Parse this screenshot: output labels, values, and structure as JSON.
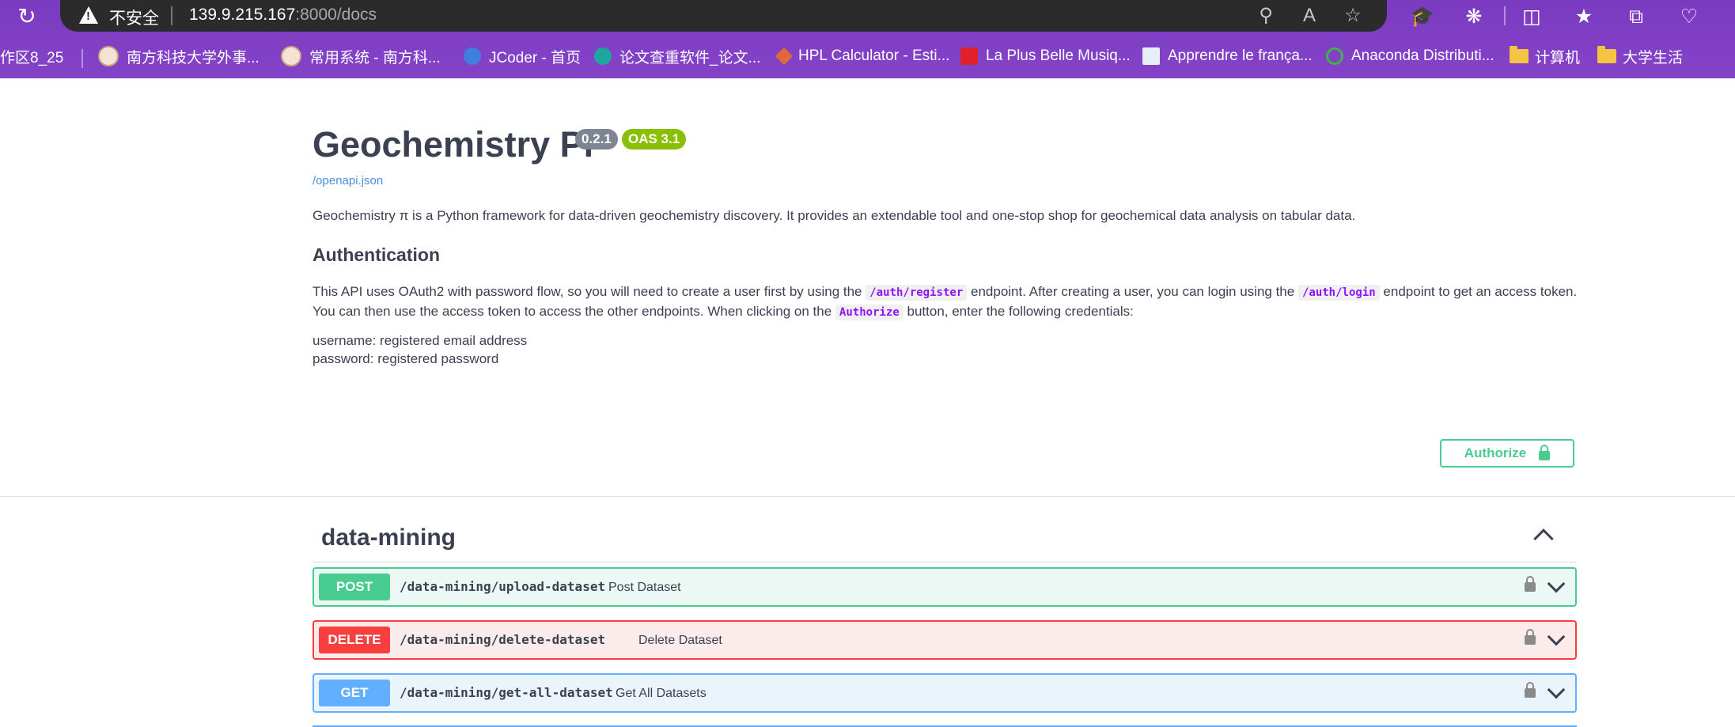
{
  "browser": {
    "insecure_label": "不安全",
    "url_host": "139.9.215.167",
    "url_rest": ":8000/docs",
    "bookmarks": [
      {
        "label": "作区8_25",
        "icon": "none"
      },
      {
        "label": "南方科技大学外事...",
        "icon": "sustech-icon"
      },
      {
        "label": "常用系统 - 南方科...",
        "icon": "sustech-icon"
      },
      {
        "label": "JCoder - 首页",
        "icon": "jcoder-icon"
      },
      {
        "label": "论文查重软件_论文...",
        "icon": "paper-check-icon"
      },
      {
        "label": "HPL Calculator - Esti...",
        "icon": "hpl-icon"
      },
      {
        "label": "La Plus Belle Musiq...",
        "icon": "cherie-icon"
      },
      {
        "label": "Apprendre le frança...",
        "icon": "grid-icon"
      },
      {
        "label": "Anaconda Distributi...",
        "icon": "anaconda-icon"
      },
      {
        "label": "计算机",
        "icon": "folder-icon"
      },
      {
        "label": "大学生活",
        "icon": "folder-icon"
      }
    ]
  },
  "api": {
    "title": "Geochemistry Pi",
    "version": "0.2.1",
    "oas": "OAS 3.1",
    "spec_link": "/openapi.json",
    "description": "Geochemistry π is a Python framework for data-driven geochemistry discovery. It provides an extendable tool and one-stop shop for geochemical data analysis on tabular data.",
    "auth_heading": "Authentication",
    "auth_text_1": "This API uses OAuth2 with password flow, so you will need to create a user first by using the",
    "auth_code_1": "/auth/register",
    "auth_text_2": "endpoint. After creating a user, you can login using the",
    "auth_code_2": "/auth/login",
    "auth_text_3": "endpoint to get an access token. You can then use the access token to access the other endpoints. When clicking on the",
    "auth_code_3": "Authorize",
    "auth_text_4": "button, enter the following credentials:",
    "cred_username": "username: registered email address",
    "cred_password": "password: registered password",
    "authorize_label": "Authorize"
  },
  "tag": {
    "name": "data-mining",
    "operations": [
      {
        "method": "POST",
        "path": "/data-mining/upload-dataset",
        "summary": "Post Dataset"
      },
      {
        "method": "DELETE",
        "path": "/data-mining/delete-dataset",
        "summary": "Delete Dataset"
      },
      {
        "method": "GET",
        "path": "/data-mining/get-all-dataset",
        "summary": "Get All Datasets"
      }
    ]
  }
}
